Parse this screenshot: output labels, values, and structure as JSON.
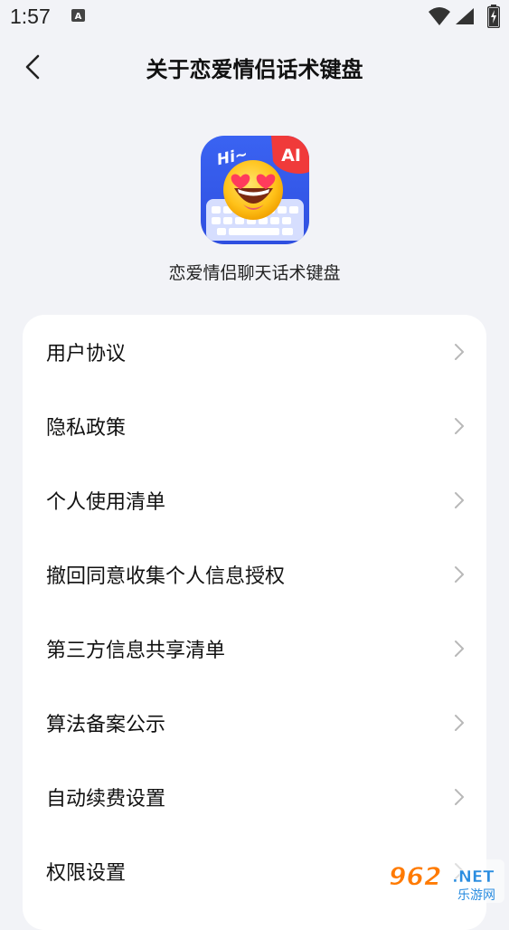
{
  "status_bar": {
    "time": "1:57",
    "icons": [
      "a-notification-icon",
      "wifi-icon",
      "cellular-signal-icon",
      "battery-charging-icon"
    ]
  },
  "header": {
    "title": "关于恋爱情侣话术键盘",
    "back_icon": "chevron-left-icon"
  },
  "app": {
    "icon_badge": "AI",
    "icon_greeting": "Hi~",
    "name": "恋爱情侣聊天话术键盘"
  },
  "menu": {
    "items": [
      {
        "label": "用户协议"
      },
      {
        "label": "隐私政策"
      },
      {
        "label": "个人使用清单"
      },
      {
        "label": "撤回同意收集个人信息授权"
      },
      {
        "label": "第三方信息共享清单"
      },
      {
        "label": "算法备案公示"
      },
      {
        "label": "自动续费设置"
      },
      {
        "label": "权限设置"
      }
    ]
  },
  "watermark": {
    "number": "962",
    "suffix": ".NET",
    "site_name": "乐游网"
  },
  "colors": {
    "background": "#f2f3f7",
    "card": "#ffffff",
    "chevron": "#b8b8b8",
    "icon_blue": "#3a5ff0",
    "icon_red": "#f03a3a"
  }
}
